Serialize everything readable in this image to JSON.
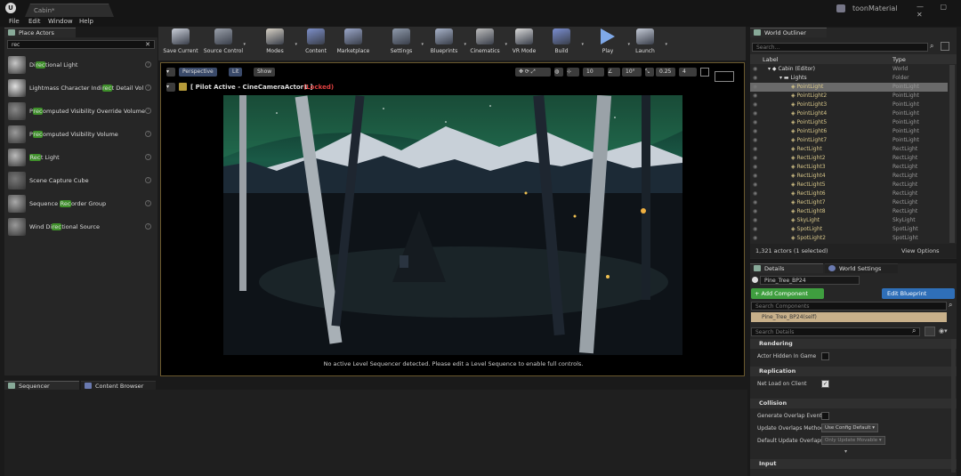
{
  "title_bar": {
    "doc_tab": "Cabin*",
    "project": "toonMaterial",
    "window_buttons": "— ▢ ✕"
  },
  "menu": [
    "File",
    "Edit",
    "Window",
    "Help"
  ],
  "place_actors": {
    "tab": "Place Actors",
    "search_value": "rec",
    "clear_icon": "✕",
    "items": [
      {
        "pre": "Di",
        "hl": "rec",
        "post": "tional Light"
      },
      {
        "pre": "Lightmass Character Indi",
        "hl": "rec",
        "post": "t Detail Vol"
      },
      {
        "pre": "P",
        "hl": "rec",
        "post": "omputed Visibility Override Volume"
      },
      {
        "pre": "P",
        "hl": "rec",
        "post": "omputed Visibility Volume"
      },
      {
        "pre": "",
        "hl": "Rec",
        "post": "t Light"
      },
      {
        "pre": "Scene Capture Cube",
        "hl": "",
        "post": ""
      },
      {
        "pre": "Sequence ",
        "hl": "Rec",
        "post": "order Group"
      },
      {
        "pre": "Wind Di",
        "hl": "rec",
        "post": "tional Source"
      }
    ]
  },
  "toolbar": [
    {
      "label": "Save Current",
      "icon": "save-icon",
      "color": "#c9ced8",
      "caret": false
    },
    {
      "label": "Source Control",
      "icon": "source-control-icon",
      "color": "#9aa0aa",
      "caret": true
    },
    {
      "label": "Modes",
      "icon": "modes-icon",
      "color": "#d6d0c4",
      "caret": true
    },
    {
      "label": "Content",
      "icon": "content-icon",
      "color": "#7d8fc8",
      "caret": false
    },
    {
      "label": "Marketplace",
      "icon": "marketplace-icon",
      "color": "#9aa6c8",
      "caret": false
    },
    {
      "label": "Settings",
      "icon": "settings-icon",
      "color": "#8f9aab",
      "caret": true
    },
    {
      "label": "Blueprints",
      "icon": "blueprints-icon",
      "color": "#a7b2c8",
      "caret": true
    },
    {
      "label": "Cinematics",
      "icon": "cinematics-icon",
      "color": "#bcbcbc",
      "caret": true
    },
    {
      "label": "VR Mode",
      "icon": "vr-mode-icon",
      "color": "#d8d8d8",
      "caret": false
    },
    {
      "label": "Build",
      "icon": "build-icon",
      "color": "#7a8ed0",
      "caret": true
    },
    {
      "label": "Play",
      "icon": "play-icon",
      "color": "#7fa9e8",
      "caret": true
    },
    {
      "label": "Launch",
      "icon": "launch-icon",
      "color": "#c4cad6",
      "caret": true
    }
  ],
  "viewport": {
    "perspective": "Perspective",
    "lit": "Lit",
    "show": "Show",
    "pilot_text": "[ Pilot Active - CineCameraActor1 ]",
    "locked": "(Locked)",
    "grid_value": "10",
    "angle_value": "10°",
    "scale_value": "0.25",
    "cam_speed": "4",
    "message": "No active Level Sequencer detected. Please edit a Level Sequence to enable full controls."
  },
  "bottom_tabs": [
    "Sequencer",
    "Content Browser"
  ],
  "outliner": {
    "tab": "World Outliner",
    "search_placeholder": "Search...",
    "col_label": "Label",
    "col_type": "Type",
    "rows": [
      {
        "label": "Cabin (Editor)",
        "type": "World",
        "indent": 0,
        "folder": false
      },
      {
        "label": "Lights",
        "type": "Folder",
        "indent": 1,
        "folder": true
      },
      {
        "label": "PointLight",
        "type": "PointLight",
        "indent": 2,
        "folder": false
      },
      {
        "label": "PointLight2",
        "type": "PointLight",
        "indent": 2,
        "folder": false
      },
      {
        "label": "PointLight3",
        "type": "PointLight",
        "indent": 2,
        "folder": false
      },
      {
        "label": "PointLight4",
        "type": "PointLight",
        "indent": 2,
        "folder": false
      },
      {
        "label": "PointLight5",
        "type": "PointLight",
        "indent": 2,
        "folder": false
      },
      {
        "label": "PointLight6",
        "type": "PointLight",
        "indent": 2,
        "folder": false
      },
      {
        "label": "PointLight7",
        "type": "PointLight",
        "indent": 2,
        "folder": false
      },
      {
        "label": "RectLight",
        "type": "RectLight",
        "indent": 2,
        "folder": false
      },
      {
        "label": "RectLight2",
        "type": "RectLight",
        "indent": 2,
        "folder": false
      },
      {
        "label": "RectLight3",
        "type": "RectLight",
        "indent": 2,
        "folder": false
      },
      {
        "label": "RectLight4",
        "type": "RectLight",
        "indent": 2,
        "folder": false
      },
      {
        "label": "RectLight5",
        "type": "RectLight",
        "indent": 2,
        "folder": false
      },
      {
        "label": "RectLight6",
        "type": "RectLight",
        "indent": 2,
        "folder": false
      },
      {
        "label": "RectLight7",
        "type": "RectLight",
        "indent": 2,
        "folder": false
      },
      {
        "label": "RectLight8",
        "type": "RectLight",
        "indent": 2,
        "folder": false
      },
      {
        "label": "SkyLight",
        "type": "SkyLight",
        "indent": 2,
        "folder": false
      },
      {
        "label": "SpotLight",
        "type": "SpotLight",
        "indent": 2,
        "folder": false
      },
      {
        "label": "SpotLight2",
        "type": "SpotLight",
        "indent": 2,
        "folder": false
      }
    ],
    "count": "1,321 actors (1 selected)",
    "view_options": "View Options"
  },
  "details": {
    "tab_details": "Details",
    "tab_world": "World Settings",
    "object_name": "Pine_Tree_BP24",
    "add_component": "+ Add Component",
    "edit_blueprint": "Edit Blueprint",
    "search_components": "Search Components",
    "self_row": "Pine_Tree_BP24(self)",
    "search_details": "Search Details",
    "sections": {
      "rendering": "Rendering",
      "replication": "Replication",
      "collision": "Collision",
      "input": "Input"
    },
    "props": {
      "actor_hidden": "Actor Hidden In Game",
      "net_load": "Net Load on Client",
      "gen_overlap": "Generate Overlap Events",
      "update_overlaps": "Update Overlaps Method",
      "update_overlaps_value": "Use Config Default",
      "default_update": "Default Update Overlaps",
      "default_update_value": "Only Update Movable"
    }
  }
}
